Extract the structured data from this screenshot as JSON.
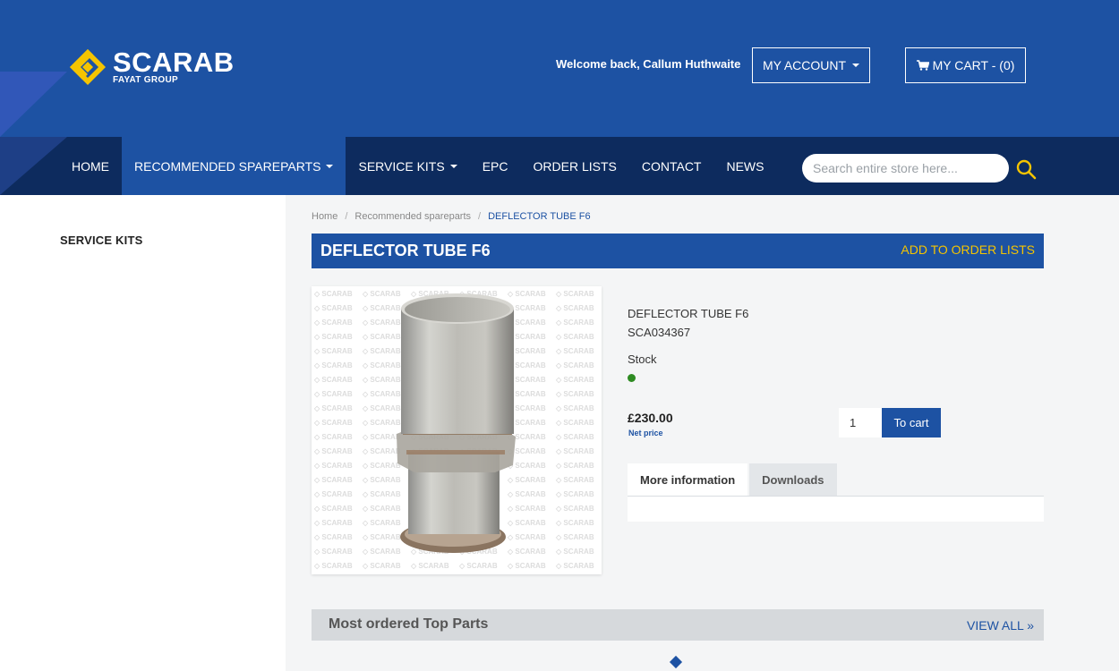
{
  "brand": {
    "name": "SCARAB",
    "sub": "FAYAT GROUP",
    "primary": "#1d52a3",
    "navy": "#0d2b5e",
    "accent": "#f5c400"
  },
  "header": {
    "welcome": "Welcome back, Callum Huthwaite",
    "account_label": "MY ACCOUNT",
    "cart_label": "MY CART - (0)"
  },
  "nav": {
    "items": [
      {
        "label": "HOME"
      },
      {
        "label": "RECOMMENDED SPAREPARTS"
      },
      {
        "label": "SERVICE KITS"
      },
      {
        "label": "EPC"
      },
      {
        "label": "ORDER LISTS"
      },
      {
        "label": "CONTACT"
      },
      {
        "label": "NEWS"
      }
    ],
    "search_placeholder": "Search entire store here..."
  },
  "sidebar": {
    "title": "SERVICE KITS"
  },
  "breadcrumb": {
    "home": "Home",
    "parent": "Recommended spareparts",
    "current": "DEFLECTOR TUBE F6"
  },
  "product": {
    "title": "DEFLECTOR TUBE F6",
    "add_to_lists": "ADD TO ORDER LISTS",
    "name": "DEFLECTOR TUBE F6",
    "sku": "SCA034367",
    "stock_label": "Stock",
    "price": "£230.00",
    "price_note": "Net price",
    "qty": "1",
    "to_cart": "To cart",
    "tabs": [
      "More information",
      "Downloads"
    ],
    "watermark": "SCARAB"
  },
  "top_parts": {
    "title": "Most ordered Top Parts",
    "view_all": "VIEW ALL »"
  }
}
